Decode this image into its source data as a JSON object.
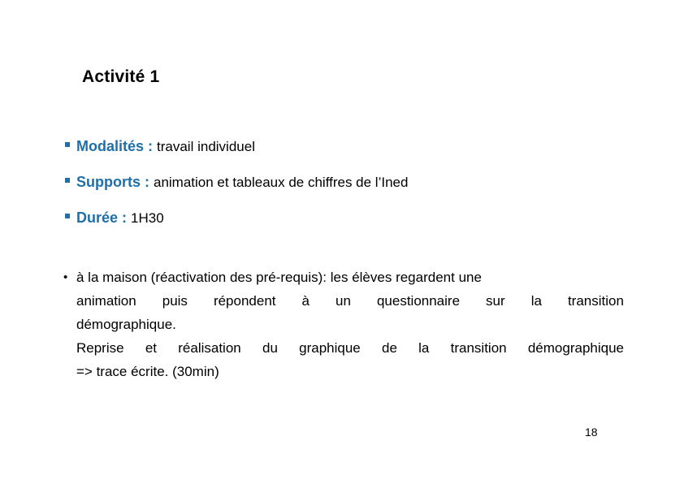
{
  "slide": {
    "title": "Activité 1",
    "page_number": "18",
    "accent_color": "#1f6fa8",
    "text_color": "#000000",
    "background_color": "#ffffff"
  },
  "meta": {
    "bullet_glyph": "square-bullet",
    "items": [
      {
        "label": "Modalités : ",
        "value": "travail individuel"
      },
      {
        "label": "Supports : ",
        "value": "animation et tableaux de chiffres de l’Ined"
      },
      {
        "label": "Durée : ",
        "value": "1H30"
      }
    ]
  },
  "body": {
    "bullet_glyph": "•",
    "paragraph_one": {
      "line1": "à la maison (réactivation des pré-requis): les élèves regardent une",
      "line2_words": [
        "animation",
        "puis",
        "répondent",
        "à",
        "un",
        "questionnaire",
        "sur",
        "la",
        "transition"
      ],
      "line3": "démographique."
    },
    "paragraph_two": {
      "line1_words": [
        "Reprise",
        "et",
        "réalisation",
        "du",
        "graphique",
        "de",
        "la",
        "transition",
        "démographique"
      ],
      "line2": "=> trace écrite. (30min)"
    }
  }
}
